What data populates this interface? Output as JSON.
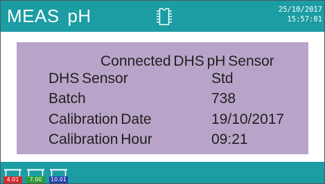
{
  "header": {
    "title": "MEAS pH",
    "date": "25/10/2017",
    "time": "15:57:01",
    "icon": "sensor-chip-icon"
  },
  "info_panel": {
    "heading": "Connected DHS pH Sensor",
    "rows": [
      {
        "label": "DHS Sensor",
        "value": "Std"
      },
      {
        "label": "Batch",
        "value": "738"
      },
      {
        "label": "Calibration Date",
        "value": "19/10/2017"
      },
      {
        "label": "Calibration Hour",
        "value": "09:21"
      }
    ]
  },
  "footer": {
    "buffers": [
      {
        "label": "4.01",
        "color": "#d42a2a",
        "icon": "buffer-bottle-icon"
      },
      {
        "label": "7.00",
        "color": "#2e9a34",
        "icon": "buffer-bottle-icon"
      },
      {
        "label": "10.01",
        "color": "#2440a8",
        "icon": "buffer-bottle-icon"
      }
    ]
  },
  "colors": {
    "bar": "#1c9ca3",
    "panel": "#b9a4c9",
    "panel_text": "#1f1f1f",
    "header_text": "#ffffff"
  }
}
